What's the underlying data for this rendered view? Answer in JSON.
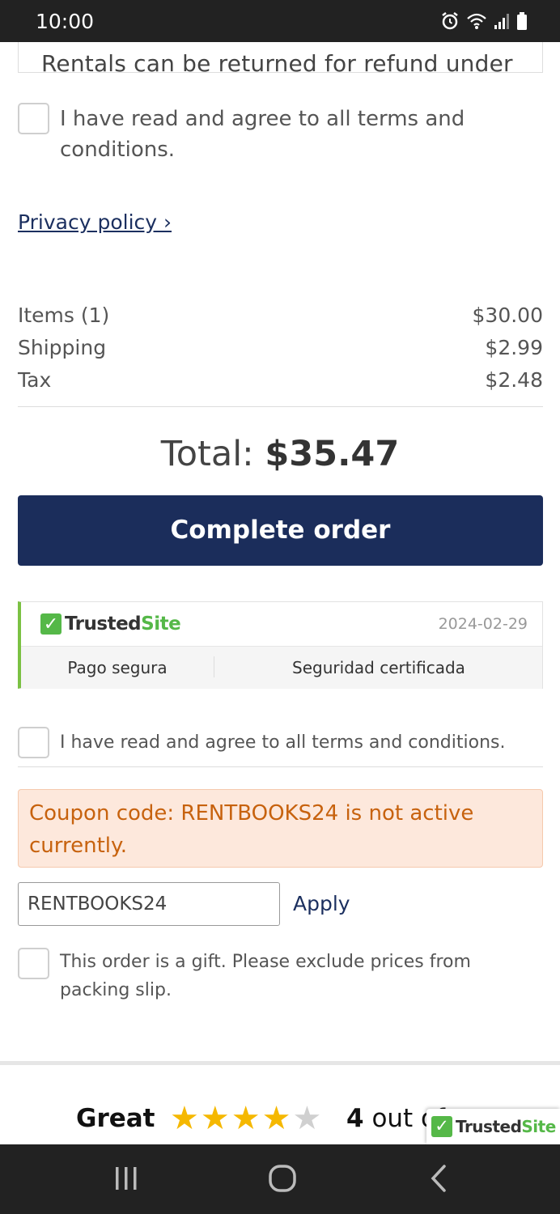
{
  "status_bar": {
    "time": "10:00",
    "icons": [
      "alarm-icon",
      "wifi-icon",
      "signal-icon",
      "battery-icon"
    ]
  },
  "terms_box": {
    "visible_text": "Rentals can be returned for refund under"
  },
  "terms_checkbox_1": {
    "label": "I have read and agree to all terms and conditions.",
    "checked": false
  },
  "privacy": {
    "link_text": "Privacy policy ›"
  },
  "summary": {
    "rows": [
      {
        "label": "Items (1)",
        "value": "$30.00"
      },
      {
        "label": "Shipping",
        "value": "$2.99"
      },
      {
        "label": "Tax",
        "value": "$2.48"
      }
    ],
    "total_label": "Total:",
    "total_value": "$35.47"
  },
  "complete_button": {
    "label": "Complete order",
    "color": "#1b2d5b"
  },
  "trusted_site": {
    "logo_part1": "Trusted",
    "logo_part2": "Site",
    "date": "2024-02-29",
    "badges": [
      "Pago segura",
      "Seguridad certificada"
    ],
    "accent": "#7bc143"
  },
  "terms_checkbox_2": {
    "label": "I have read and agree to all terms and conditions.",
    "checked": false
  },
  "coupon_alert": {
    "message": "Coupon code: RENTBOOKS24 is not active currently.",
    "color": "#c7620e"
  },
  "coupon": {
    "value": "RENTBOOKS24",
    "apply_label": "Apply"
  },
  "gift_checkbox": {
    "label": "This order is a gift. Please exclude prices from packing slip.",
    "checked": false
  },
  "rating": {
    "word": "Great",
    "stars": 4,
    "max_stars": 5,
    "count": "4",
    "suffix": "out of"
  },
  "trusted_float": {
    "logo_part1": "Trusted",
    "logo_part2": "Site"
  },
  "nav": {
    "icons": [
      "recent-apps-icon",
      "home-icon",
      "back-icon"
    ]
  }
}
